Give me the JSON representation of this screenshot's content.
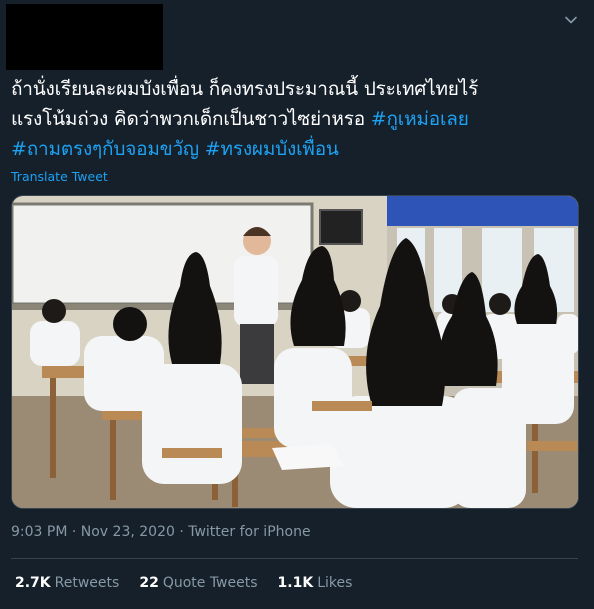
{
  "tweet": {
    "text_lines": [
      [
        {
          "t": "ถ้านั่งเรียนละผมบังเพื่อน ก็คงทรงประมาณนี้ ประเทศไทยไร้",
          "tag": false
        }
      ],
      [
        {
          "t": "แรงโน้มถ่วง คิดว่าพวกเด็กเป็นชาวไซย่าหรอ ",
          "tag": false
        },
        {
          "t": "#กูเหม่อเลย",
          "tag": true
        }
      ],
      [
        {
          "t": "#ถามตรงๆกับจอมขวัญ",
          "tag": true
        },
        {
          "t": " ",
          "tag": false
        },
        {
          "t": "#ทรงผมบังเพื่อน",
          "tag": true
        }
      ]
    ],
    "translate_label": "Translate Tweet",
    "meta": "9:03 PM · Nov 23, 2020 · Twitter for iPhone"
  },
  "stats": {
    "retweets_count": "2.7K",
    "retweets_label": "Retweets",
    "quotes_count": "22",
    "quotes_label": "Quote Tweets",
    "likes_count": "1.1K",
    "likes_label": "Likes"
  },
  "colors": {
    "background": "#15202b",
    "link": "#1da1f2",
    "muted": "#8899a6",
    "divider": "#38444d"
  },
  "icons": {
    "more": "chevron-down-icon"
  }
}
